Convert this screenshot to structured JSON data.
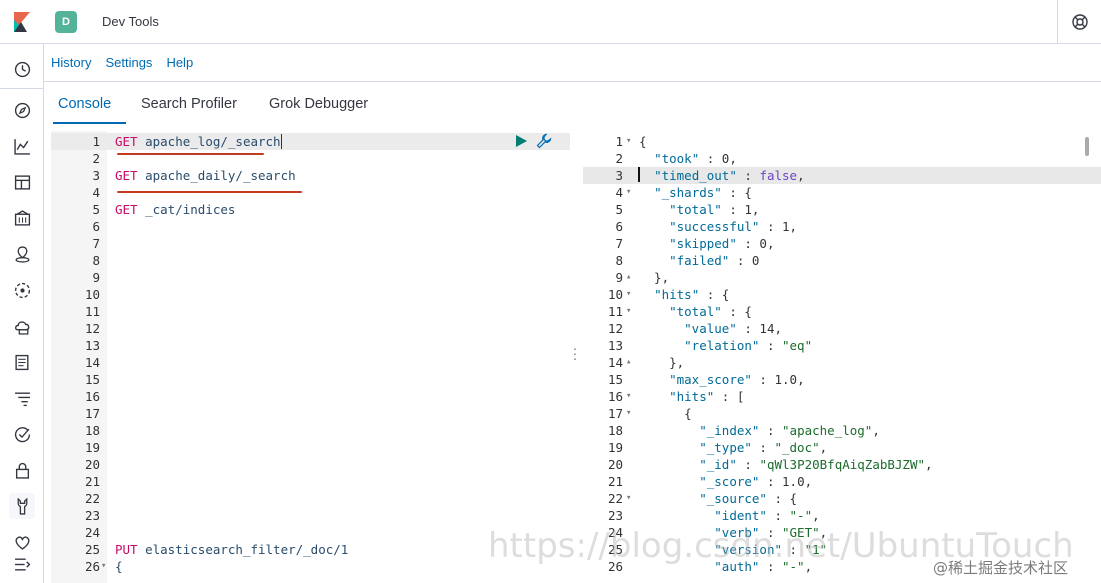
{
  "app": {
    "title": "Dev Tools",
    "badge": "D"
  },
  "menu": [
    {
      "label": "History"
    },
    {
      "label": "Settings"
    },
    {
      "label": "Help"
    }
  ],
  "tabs": [
    {
      "label": "Console",
      "active": true
    },
    {
      "label": "Search Profiler",
      "active": false
    },
    {
      "label": "Grok Debugger",
      "active": false
    }
  ],
  "sidenav_icons": [
    "clock-icon",
    "discover-icon",
    "visualize-icon",
    "dashboard-icon",
    "canvas-icon",
    "maps-icon",
    "ml-icon",
    "infrastructure-icon",
    "logs-icon",
    "apm-icon",
    "uptime-icon",
    "security-icon",
    "dev-tools-icon",
    "monitoring-icon",
    "collapse-icon"
  ],
  "request_editor": {
    "lines": [
      {
        "n": "1",
        "method": "GET",
        "path": "apache_log/_search"
      },
      {
        "n": "2",
        "method": "",
        "path": ""
      },
      {
        "n": "3",
        "method": "GET",
        "path": "apache_daily/_search"
      },
      {
        "n": "4",
        "method": "",
        "path": ""
      },
      {
        "n": "5",
        "method": "GET",
        "path": "_cat/indices"
      },
      {
        "n": "6"
      },
      {
        "n": "7"
      },
      {
        "n": "8"
      },
      {
        "n": "9"
      },
      {
        "n": "10"
      },
      {
        "n": "11"
      },
      {
        "n": "12"
      },
      {
        "n": "13"
      },
      {
        "n": "14"
      },
      {
        "n": "15"
      },
      {
        "n": "16"
      },
      {
        "n": "17"
      },
      {
        "n": "18"
      },
      {
        "n": "19"
      },
      {
        "n": "20"
      },
      {
        "n": "21"
      },
      {
        "n": "22"
      },
      {
        "n": "23"
      },
      {
        "n": "24"
      },
      {
        "n": "25",
        "method": "PUT",
        "path": "elasticsearch_filter/_doc/1"
      },
      {
        "n": "26",
        "method": "",
        "path": "{",
        "fold": "▾"
      }
    ]
  },
  "response_editor": {
    "lines": [
      {
        "n": "1",
        "fold": "▾",
        "text": "{"
      },
      {
        "n": "2",
        "text": "  \"took\" : 0,"
      },
      {
        "n": "3",
        "text": "  \"timed_out\" : false,"
      },
      {
        "n": "4",
        "fold": "▾",
        "text": "  \"_shards\" : {"
      },
      {
        "n": "5",
        "text": "    \"total\" : 1,"
      },
      {
        "n": "6",
        "text": "    \"successful\" : 1,"
      },
      {
        "n": "7",
        "text": "    \"skipped\" : 0,"
      },
      {
        "n": "8",
        "text": "    \"failed\" : 0"
      },
      {
        "n": "9",
        "fold": "▴",
        "text": "  },"
      },
      {
        "n": "10",
        "fold": "▾",
        "text": "  \"hits\" : {"
      },
      {
        "n": "11",
        "fold": "▾",
        "text": "    \"total\" : {"
      },
      {
        "n": "12",
        "text": "      \"value\" : 14,"
      },
      {
        "n": "13",
        "text": "      \"relation\" : \"eq\""
      },
      {
        "n": "14",
        "fold": "▴",
        "text": "    },"
      },
      {
        "n": "15",
        "text": "    \"max_score\" : 1.0,"
      },
      {
        "n": "16",
        "fold": "▾",
        "text": "    \"hits\" : ["
      },
      {
        "n": "17",
        "fold": "▾",
        "text": "      {"
      },
      {
        "n": "18",
        "text": "        \"_index\" : \"apache_log\","
      },
      {
        "n": "19",
        "text": "        \"_type\" : \"_doc\","
      },
      {
        "n": "20",
        "text": "        \"_id\" : \"qWl3P20BfqAiqZabBJZW\","
      },
      {
        "n": "21",
        "text": "        \"_score\" : 1.0,"
      },
      {
        "n": "22",
        "fold": "▾",
        "text": "        \"_source\" : {"
      },
      {
        "n": "23",
        "text": "          \"ident\" : \"-\","
      },
      {
        "n": "24",
        "text": "          \"verb\" : \"GET\","
      },
      {
        "n": "25",
        "text": "          \"version\" : \"1\""
      },
      {
        "n": "26",
        "text": "          \"auth\" : \"-\","
      }
    ]
  },
  "watermark": "https://blog.csdn.net/UbuntuTouch",
  "watermark_cn": "@稀土掘金技术社区"
}
